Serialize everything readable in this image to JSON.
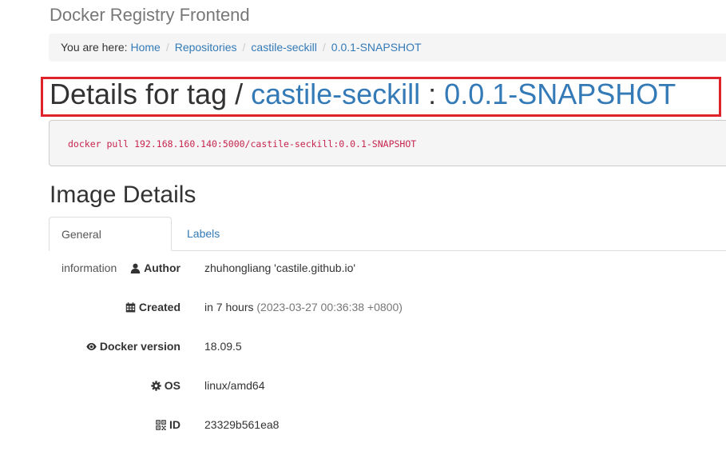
{
  "app": {
    "title": "Docker Registry Frontend"
  },
  "breadcrumb": {
    "prefix": "You are here:",
    "items": [
      "Home",
      "Repositories",
      "castile-seckill",
      "0.0.1-SNAPSHOT"
    ],
    "separator": "/"
  },
  "heading": {
    "text": "Details for tag / ",
    "repository": "castile-seckill",
    "colon": " : ",
    "tag": "0.0.1-SNAPSHOT"
  },
  "pull_command": "docker pull 192.168.160.140:5000/castile-seckill:0.0.1-SNAPSHOT",
  "image_details": {
    "title": "Image Details",
    "tabs": [
      {
        "label": "General information",
        "active": true
      },
      {
        "label": "Labels",
        "active": false
      }
    ],
    "fields": [
      {
        "icon": "user-icon",
        "label": "Author",
        "value": "zhuhongliang 'castile.github.io'"
      },
      {
        "icon": "calendar-icon",
        "label": "Created",
        "value": "in 7 hours",
        "detail": "(2023-03-27 00:36:38 +0800)"
      },
      {
        "icon": "eye-icon",
        "label": "Docker version",
        "value": "18.09.5"
      },
      {
        "icon": "gear-icon",
        "label": "OS",
        "value": "linux/amd64"
      },
      {
        "icon": "qrcode-icon",
        "label": "ID",
        "value": "23329b561ea8"
      }
    ]
  },
  "colors": {
    "link": "#337ab7",
    "highlight_border": "#e0222b",
    "code": "#c7254e"
  }
}
